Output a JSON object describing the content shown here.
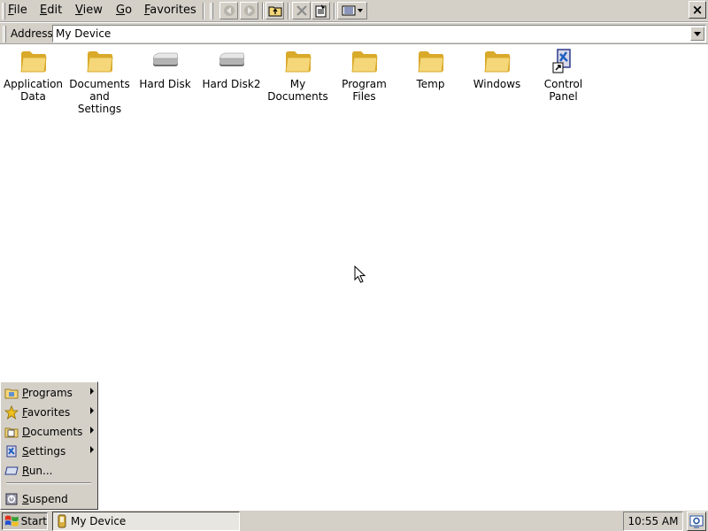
{
  "menubar": {
    "menus": [
      {
        "label": "File",
        "hotkey": "F",
        "rest": "ile"
      },
      {
        "label": "Edit",
        "hotkey": "E",
        "rest": "dit"
      },
      {
        "label": "View",
        "hotkey": "V",
        "rest": "iew"
      },
      {
        "label": "Go",
        "hotkey": "G",
        "rest": "o"
      },
      {
        "label": "Favorites",
        "hotkey": "F",
        "rest": "avorites"
      }
    ],
    "toolbar_icons": [
      "back-icon",
      "forward-icon",
      "up-folder-icon",
      "delete-icon",
      "properties-icon",
      "views-icon"
    ],
    "close_label": "×"
  },
  "address": {
    "label": "Address",
    "value": "My Device"
  },
  "items": [
    {
      "line1": "Application",
      "line2": "Data",
      "icon": "folder-icon"
    },
    {
      "line1": "Documents",
      "line2": "and Settings",
      "icon": "folder-icon"
    },
    {
      "line1": "Hard Disk",
      "line2": "",
      "icon": "disk-icon"
    },
    {
      "line1": "Hard Disk2",
      "line2": "",
      "icon": "disk-icon"
    },
    {
      "line1": "My",
      "line2": "Documents",
      "icon": "folder-icon"
    },
    {
      "line1": "Program Files",
      "line2": "",
      "icon": "folder-icon"
    },
    {
      "line1": "Temp",
      "line2": "",
      "icon": "folder-icon"
    },
    {
      "line1": "Windows",
      "line2": "",
      "icon": "folder-icon"
    },
    {
      "line1": "Control",
      "line2": "Panel",
      "icon": "control-panel-icon"
    }
  ],
  "start_menu": {
    "items": [
      {
        "hotkey": "P",
        "rest": "rograms",
        "submenu": true,
        "icon": "programs-icon"
      },
      {
        "hotkey": "F",
        "rest": "avorites",
        "submenu": true,
        "icon": "favorites-icon"
      },
      {
        "hotkey": "D",
        "rest": "ocuments",
        "submenu": true,
        "icon": "documents-icon"
      },
      {
        "hotkey": "S",
        "rest": "ettings",
        "submenu": true,
        "icon": "settings-icon"
      },
      {
        "hotkey": "R",
        "rest": "un...",
        "submenu": false,
        "icon": "run-icon"
      }
    ],
    "suspend": {
      "hotkey": "S",
      "rest": "uspend",
      "icon": "suspend-icon"
    }
  },
  "taskbar": {
    "start_label": "Start",
    "task_label": "My Device",
    "clock": "10:55 AM"
  },
  "colors": {
    "chrome": "#d4d0c8",
    "folder": "#f5d77a",
    "folder_dark": "#d9a92a"
  }
}
